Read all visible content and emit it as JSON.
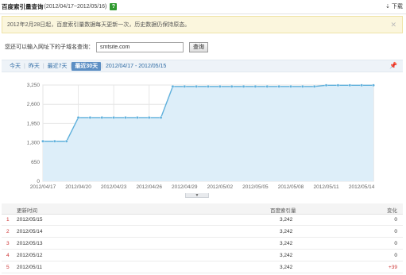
{
  "header": {
    "title": "百度索引量查询",
    "range": "(2012/04/17~2012/05/16)",
    "help": "?",
    "download": "下载"
  },
  "notice": {
    "text": "2012年2月28日起，百度索引量数据每天更新一次，历史数据仍保持原态。"
  },
  "subdomain": {
    "label": "您还可以输入网址下的子域名查询：",
    "value": "smtsite.com",
    "button": "查询"
  },
  "tabs": [
    {
      "label": "今天",
      "active": false
    },
    {
      "label": "昨天",
      "active": false
    },
    {
      "label": "最近7天",
      "active": false
    },
    {
      "label": "最近30天",
      "active": true
    }
  ],
  "range_label": "2012/04/17 - 2012/05/15",
  "chart_data": {
    "type": "area",
    "y_ticks": [
      "3,250",
      "2,600",
      "1,950",
      "1,300",
      "650",
      "0"
    ],
    "ylim": [
      0,
      3250
    ],
    "x_ticks": [
      "2012/04/17",
      "2012/04/20",
      "2012/04/23",
      "2012/04/26",
      "2012/04/29",
      "2012/05/02",
      "2012/05/05",
      "2012/05/08",
      "2012/05/11",
      "2012/05/14"
    ],
    "x": [
      "2012/04/17",
      "2012/04/18",
      "2012/04/19",
      "2012/04/20",
      "2012/04/21",
      "2012/04/22",
      "2012/04/23",
      "2012/04/24",
      "2012/04/25",
      "2012/04/26",
      "2012/04/27",
      "2012/04/28",
      "2012/04/29",
      "2012/04/30",
      "2012/05/01",
      "2012/05/02",
      "2012/05/03",
      "2012/05/04",
      "2012/05/05",
      "2012/05/06",
      "2012/05/07",
      "2012/05/08",
      "2012/05/09",
      "2012/05/10",
      "2012/05/11",
      "2012/05/12",
      "2012/05/13",
      "2012/05/14",
      "2012/05/15"
    ],
    "values": [
      1350,
      1350,
      1350,
      2150,
      2150,
      2150,
      2150,
      2150,
      2150,
      2150,
      2150,
      3200,
      3200,
      3200,
      3200,
      3200,
      3200,
      3200,
      3200,
      3200,
      3200,
      3200,
      3200,
      3200,
      3242,
      3242,
      3242,
      3242,
      3242
    ],
    "colors": {
      "line": "#5fb0dc",
      "fill": "#ddeef9",
      "marker": "#5fb0dc",
      "grid": "#e6e6e6"
    },
    "grid": true
  },
  "table": {
    "headers": {
      "date": "更新时间",
      "value": "百度索引量",
      "change": "变化"
    },
    "rows": [
      {
        "idx": "1",
        "date": "2012/05/15",
        "value": "3,242",
        "change": "0",
        "up": false
      },
      {
        "idx": "2",
        "date": "2012/05/14",
        "value": "3,242",
        "change": "0",
        "up": false
      },
      {
        "idx": "3",
        "date": "2012/05/13",
        "value": "3,242",
        "change": "0",
        "up": false
      },
      {
        "idx": "4",
        "date": "2012/05/12",
        "value": "3,242",
        "change": "0",
        "up": false
      },
      {
        "idx": "5",
        "date": "2012/05/11",
        "value": "3,242",
        "change": "+39",
        "up": true
      }
    ]
  }
}
